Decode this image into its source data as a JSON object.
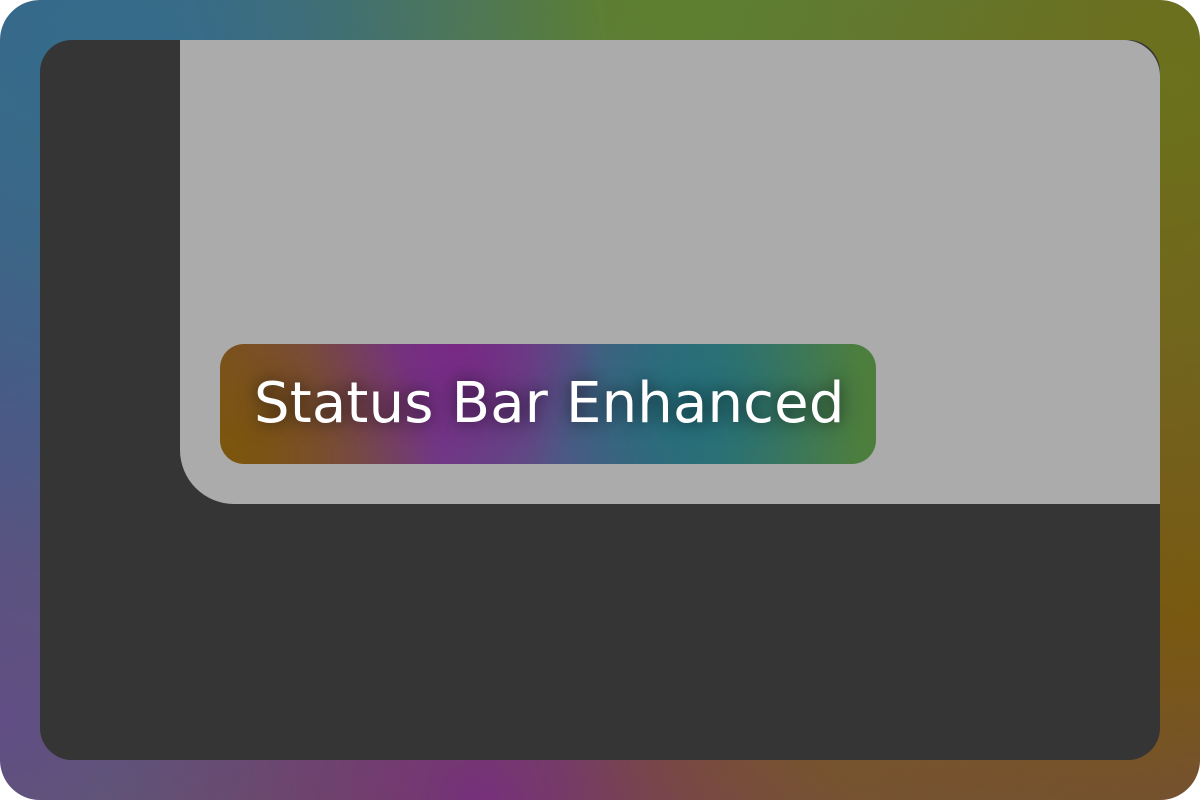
{
  "status_bar": {
    "label": "Status Bar Enhanced"
  },
  "colors": {
    "outer_frame": [
      "#3a6a86",
      "#5a7a4a",
      "#7a5a22",
      "#6a3f7a"
    ],
    "inner_panel": "#353535",
    "content_area": "#ababab",
    "status_gradient": [
      "#7a4e2a",
      "#6e3b86",
      "#2e717b",
      "#4a7d48"
    ],
    "status_text": "#ffffff"
  }
}
